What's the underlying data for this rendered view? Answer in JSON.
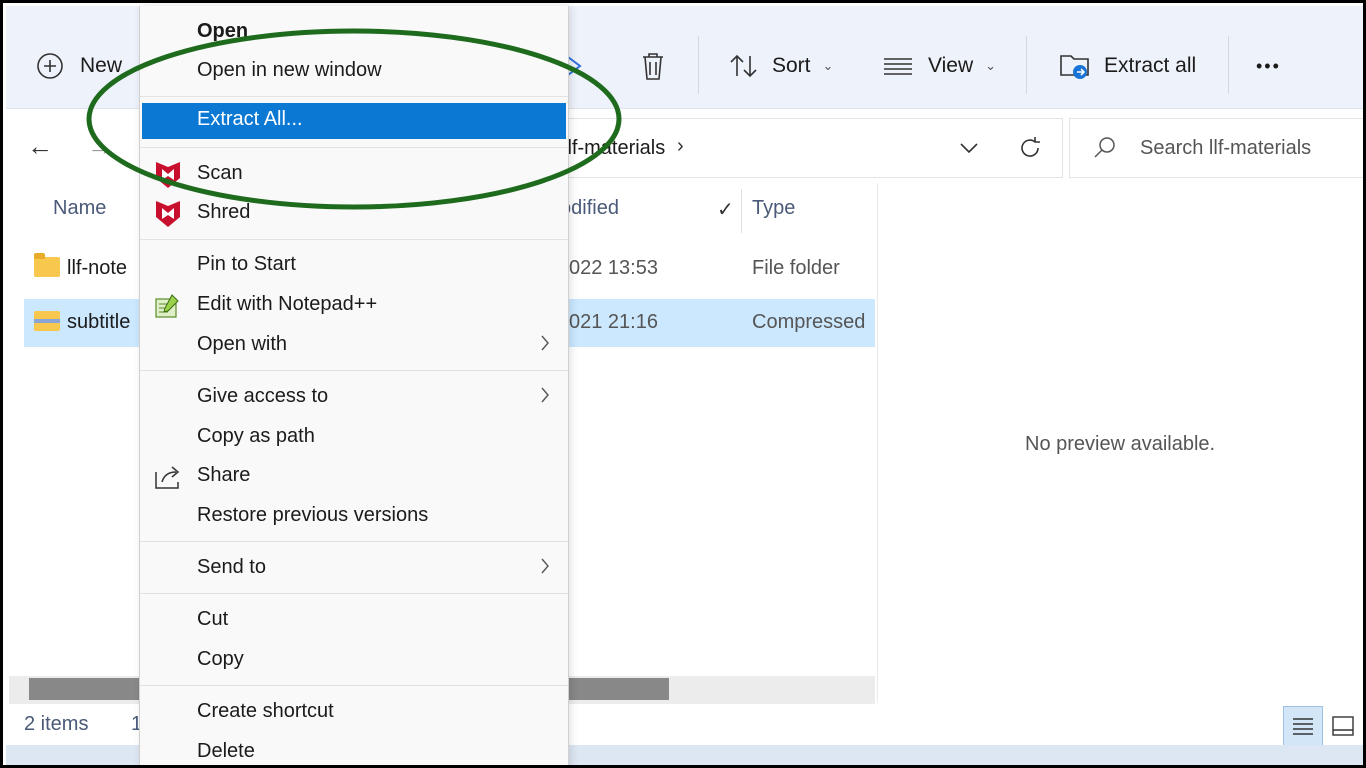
{
  "toolbar": {
    "new_label": "New",
    "sort_label": "Sort",
    "view_label": "View",
    "extract_all_label": "Extract all",
    "more_label": "•••"
  },
  "address": {
    "path_tail": "llf-materials",
    "search_placeholder": "Search llf-materials"
  },
  "columns": {
    "name": "Name",
    "modified": "odified",
    "type": "Type"
  },
  "files": [
    {
      "name": "llf-note",
      "date": "022 13:53",
      "type": "File folder"
    },
    {
      "name": "subtitle",
      "date": "021 21:16",
      "type": "Compressed"
    }
  ],
  "preview": {
    "empty_text": "No preview available."
  },
  "status": {
    "items": "2 items",
    "selected_fragment": "1"
  },
  "context_menu": {
    "open": "Open",
    "open_new_window": "Open in new window",
    "extract_all": "Extract All...",
    "scan": "Scan",
    "shred": "Shred",
    "pin_to_start": "Pin to Start",
    "edit_notepad": "Edit with Notepad++",
    "open_with": "Open with",
    "give_access": "Give access to",
    "copy_as_path": "Copy as path",
    "share": "Share",
    "restore_versions": "Restore previous versions",
    "send_to": "Send to",
    "cut": "Cut",
    "copy": "Copy",
    "create_shortcut": "Create shortcut",
    "delete": "Delete"
  },
  "colors": {
    "highlight": "#0b78d4",
    "selection": "#cce8ff",
    "annotation": "#1e6b1e",
    "mcafee_red": "#c8102e"
  }
}
